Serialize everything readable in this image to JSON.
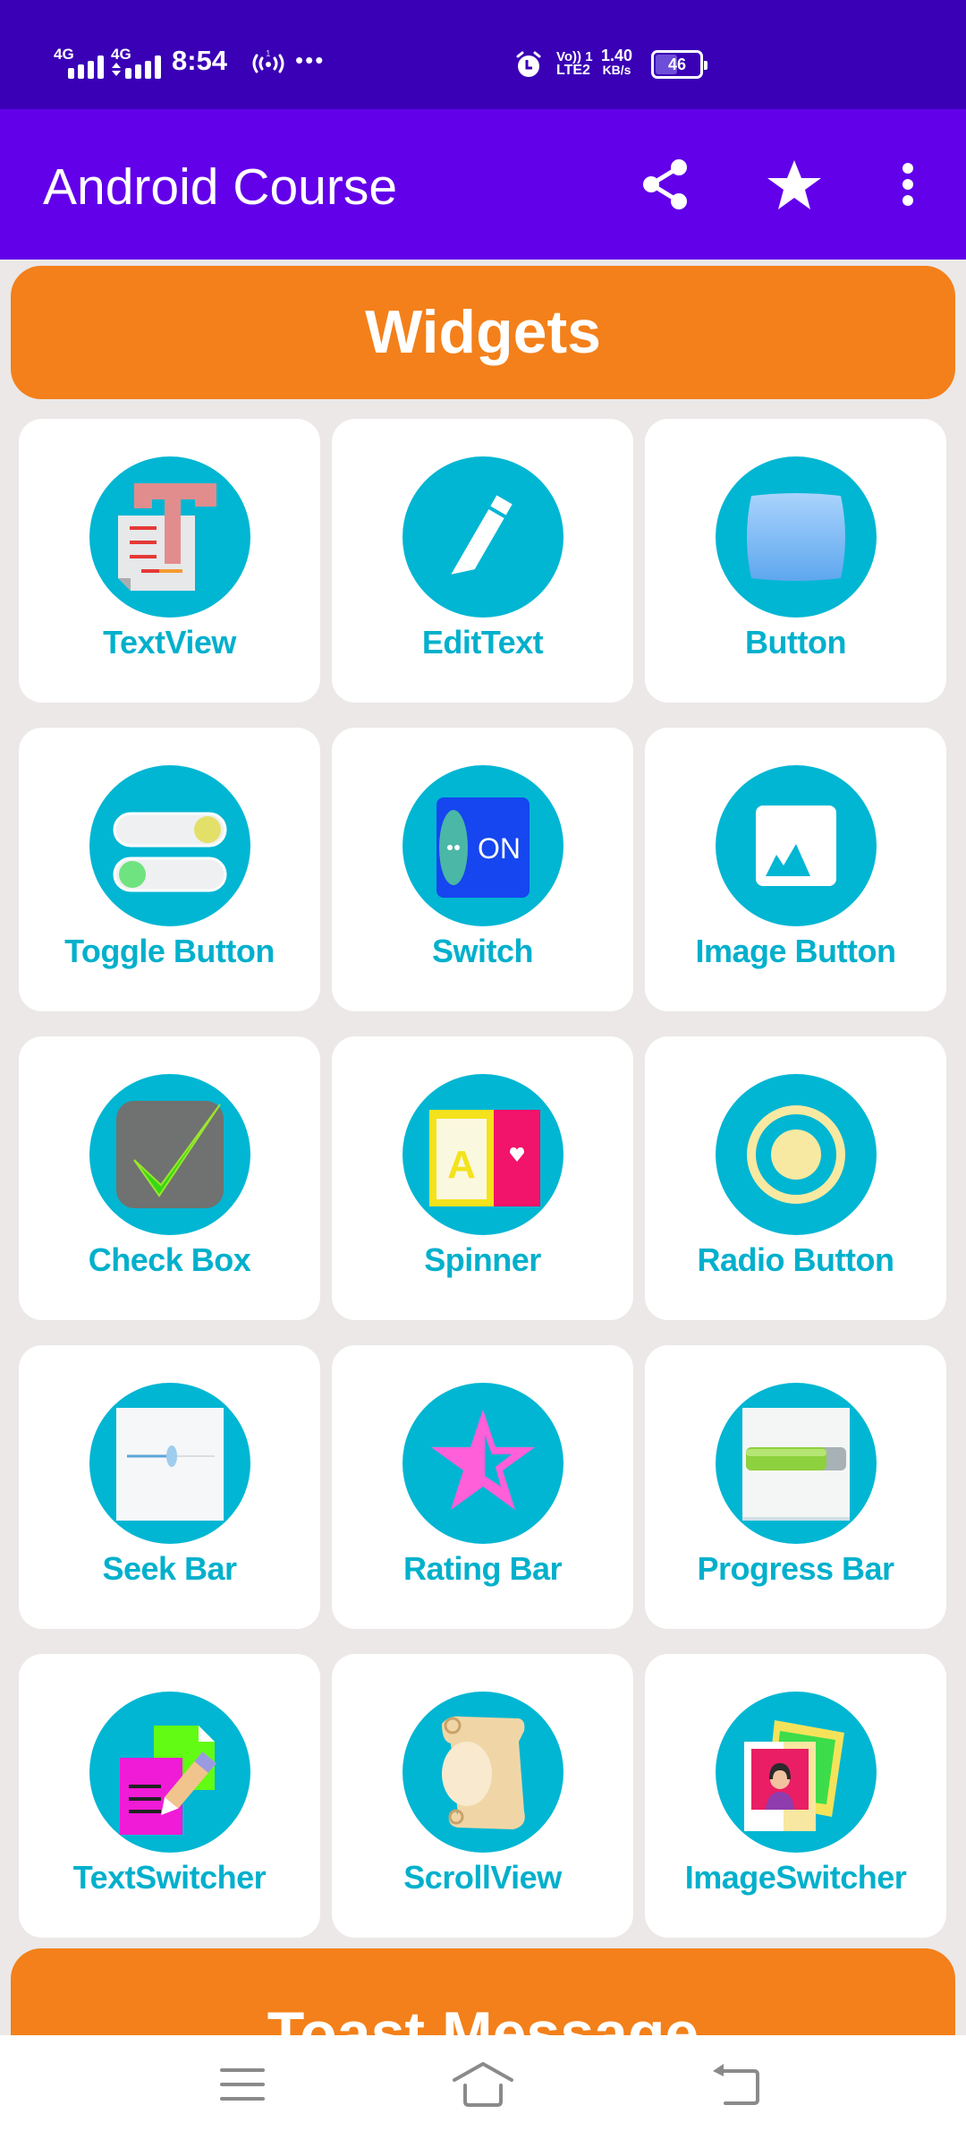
{
  "status_bar": {
    "sim1_network": "4G",
    "sim2_network": "4G",
    "time": "8:54",
    "hotspot_label": "1",
    "overflow": "•••",
    "volte_line1": "Vo)) 1",
    "volte_line2": "LTE2",
    "net_speed_value": "1.40",
    "net_speed_unit": "KB/s",
    "battery_percent": "46",
    "battery_level": 0.46
  },
  "app_bar": {
    "title": "Android Course",
    "actions": [
      {
        "name": "share",
        "icon": "share-icon"
      },
      {
        "name": "favorite",
        "icon": "star-icon"
      },
      {
        "name": "more",
        "icon": "more-vert-icon"
      }
    ]
  },
  "sections": {
    "widgets_title": "Widgets",
    "toast_title": "Toast Message"
  },
  "widgets": [
    {
      "label": "TextView",
      "icon": "textview-icon"
    },
    {
      "label": "EditText",
      "icon": "pencil-icon"
    },
    {
      "label": "Button",
      "icon": "button-icon"
    },
    {
      "label": "Toggle Button",
      "icon": "toggle-icon"
    },
    {
      "label": "Switch",
      "icon": "switch-icon"
    },
    {
      "label": "Image Button",
      "icon": "image-icon"
    },
    {
      "label": "Check Box",
      "icon": "checkbox-icon"
    },
    {
      "label": "Spinner",
      "icon": "spinner-icon"
    },
    {
      "label": "Radio Button",
      "icon": "radio-icon"
    },
    {
      "label": "Seek Bar",
      "icon": "seekbar-icon"
    },
    {
      "label": "Rating Bar",
      "icon": "rating-star-icon"
    },
    {
      "label": "Progress Bar",
      "icon": "progressbar-icon"
    },
    {
      "label": "TextSwitcher",
      "icon": "textswitcher-icon"
    },
    {
      "label": "ScrollView",
      "icon": "scroll-icon"
    },
    {
      "label": "ImageSwitcher",
      "icon": "imageswitcher-icon"
    }
  ],
  "switch_icon_text": "ON",
  "spinner_icon_letter": "A",
  "colors": {
    "status_bar": "#3a00b6",
    "app_bar": "#6200ea",
    "section_header": "#f3801a",
    "icon_circle": "#00b6d3",
    "label_text": "#00b0cc",
    "background": "#ebe8e7"
  },
  "nav_bar": {
    "buttons": [
      "menu",
      "home",
      "back"
    ]
  }
}
